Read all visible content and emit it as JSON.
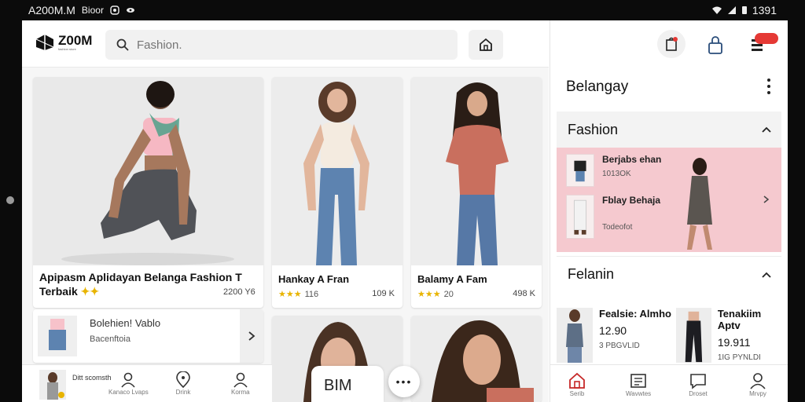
{
  "status_bar": {
    "left_text": "A200M.M",
    "app_text": "Bioor",
    "time": "1391"
  },
  "header": {
    "logo_text": "Z00M",
    "logo_sub": "fashion store",
    "search_placeholder": "Fashion."
  },
  "products": [
    {
      "title_line1": "Apipasm Aplidayan Belanga Fashion T",
      "title_line2": "Terbaik",
      "price": "2200 Y6"
    },
    {
      "title": "Hankay A Fran",
      "rating": "★★★",
      "count": "116",
      "price": "109 K"
    },
    {
      "title": "Balamy A Fam",
      "rating": "★★★",
      "count": "20",
      "price": "498 K"
    }
  ],
  "promo_list_item": {
    "title": "Bolehien! Vablo",
    "subtitle": "Bacenftoia"
  },
  "bottom_overlay": {
    "bim_label": "BIM",
    "fab_label": "•••"
  },
  "left_nav": {
    "profile_text": "Ditt scomsth",
    "items": [
      "Kanaco Lvaps",
      "Drink",
      "Korma"
    ]
  },
  "right_panel": {
    "title": "Belangay",
    "sections": [
      {
        "label": "Fashion",
        "expanded": true
      },
      {
        "label": "Felanin",
        "expanded": true
      }
    ],
    "promo": {
      "item1_title": "Berjabs ehan",
      "item1_sub": "1013OK",
      "item2_title": "Fblay Behaja",
      "item2_sub": "Todeofot"
    },
    "products": [
      {
        "title": "Fealsie: Almho",
        "price": "12.90",
        "sub": "3 PBGVLID"
      },
      {
        "title": "Tenakiim Aptv",
        "price": "19.911",
        "sub": "1IG PYNLDI"
      }
    ],
    "nav_items": [
      "Serib",
      "Wavwtes",
      "Droset",
      "Mrvpy"
    ],
    "badge_color": "#e53935"
  },
  "colors": {
    "accent": "#e8b400",
    "promo_bg": "#f5c9cf",
    "badge": "#e53935"
  }
}
